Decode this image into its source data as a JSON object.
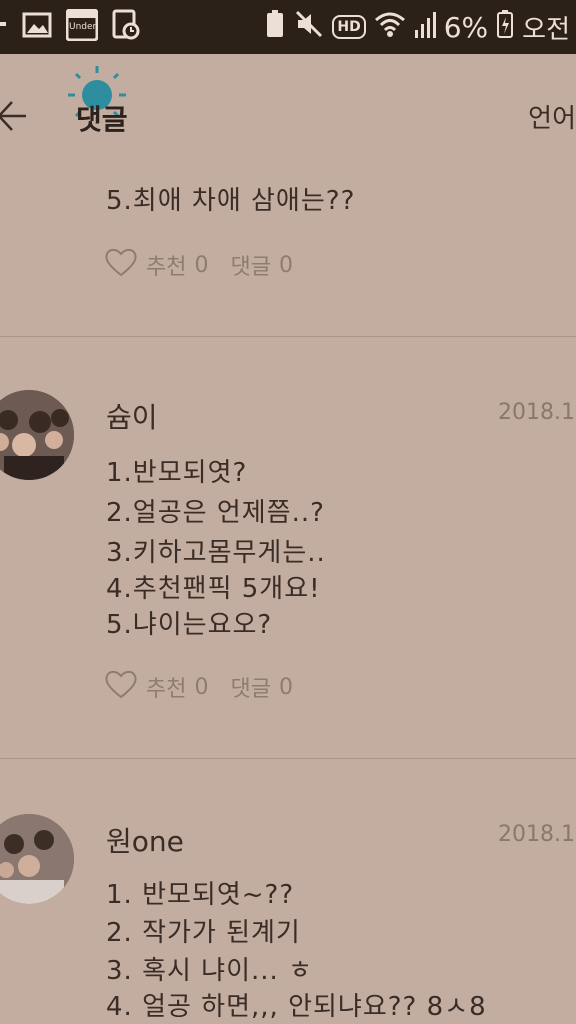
{
  "status_bar": {
    "left_icons": [
      "notification-icon",
      "image-icon",
      "under-app-icon",
      "alarm-icon"
    ],
    "under_label": "Under",
    "hd_label": "HD",
    "battery": "6%",
    "time": "오전"
  },
  "header": {
    "title": "댓글",
    "language": "언어"
  },
  "comments": [
    {
      "lines": [
        "5.최애 차애 삼애는??"
      ],
      "likes_label": "추천",
      "likes": "0",
      "replies_label": "댓글",
      "replies": "0"
    },
    {
      "author": "슘이",
      "date": "2018.1",
      "lines": [
        "1.반모되엿?",
        "2.얼공은 언제쯤..?",
        "3.키하고몸무게는..",
        "4.추천팬픽 5개요!",
        "5.냐이는요오?"
      ],
      "likes_label": "추천",
      "likes": "0",
      "replies_label": "댓글",
      "replies": "0"
    },
    {
      "author": "원one",
      "date": "2018.1",
      "lines": [
        "1. 반모되엿~??",
        "2. 작가가 된계기",
        "3. 혹시 냐이... ㅎ",
        "4. 얼공 하면,,, 안되냐요?? 8ㅅ8"
      ]
    }
  ]
}
